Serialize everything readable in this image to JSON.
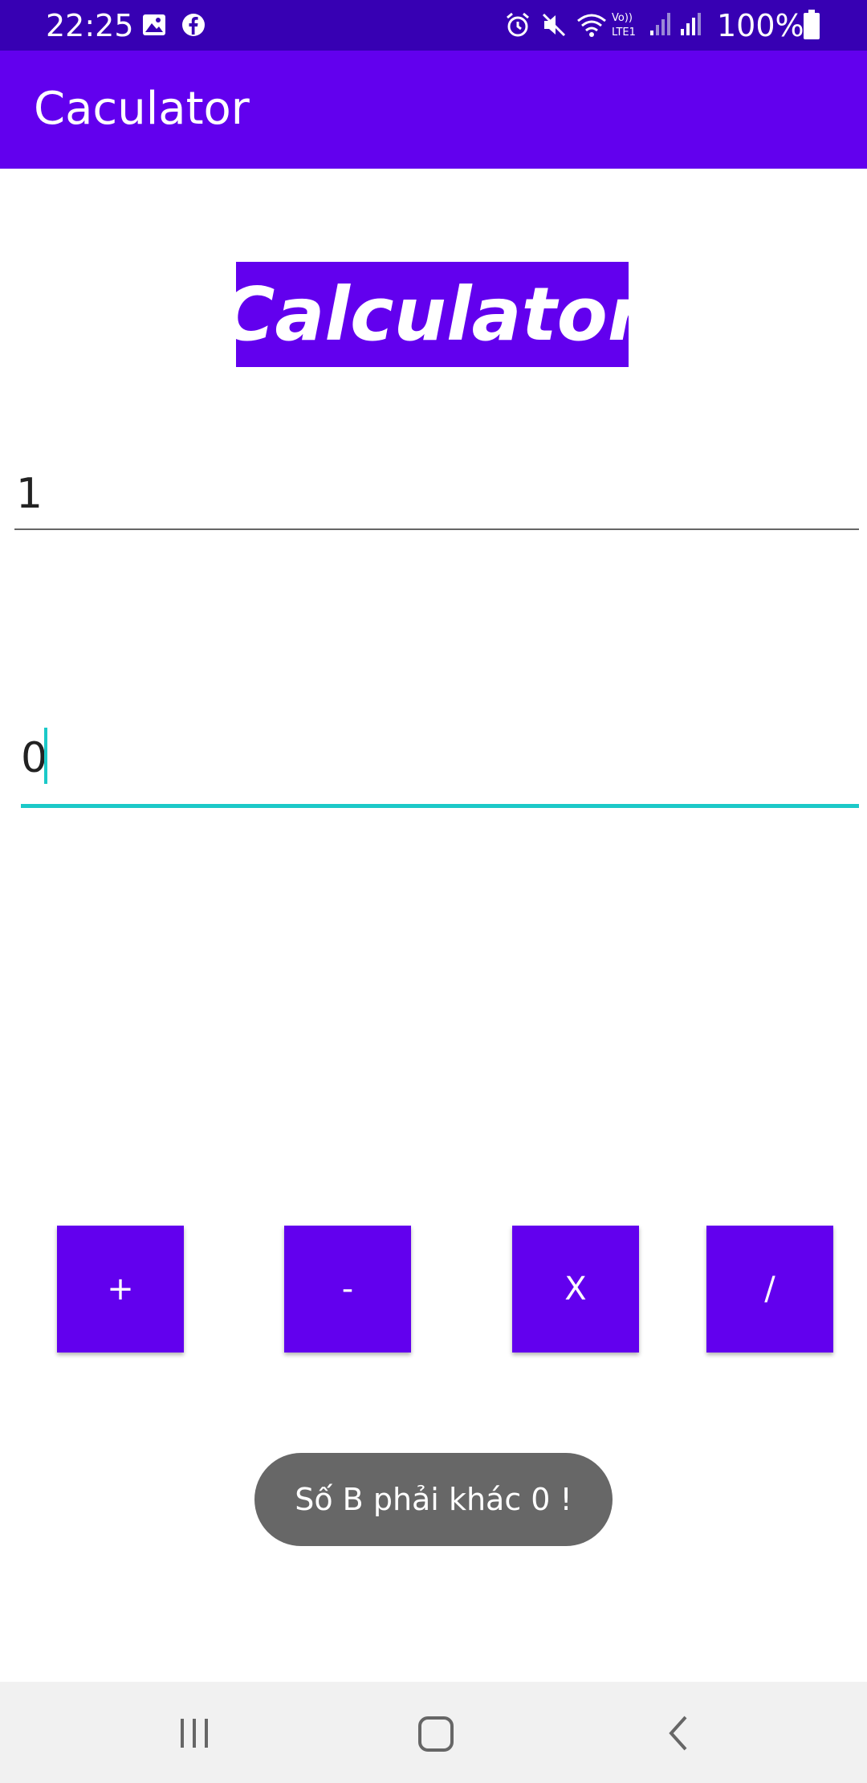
{
  "status_bar": {
    "time": "22:25",
    "battery": "100%",
    "icons": [
      "image-icon",
      "facebook-icon",
      "alarm-icon",
      "mute-icon",
      "wifi-icon",
      "volte-icon",
      "signal-icon",
      "signal-icon",
      "battery-icon"
    ]
  },
  "app_bar": {
    "title": "Caculator"
  },
  "heading": {
    "text": "Calculator"
  },
  "inputs": {
    "a_value": "1",
    "b_value": "0"
  },
  "buttons": {
    "add": "+",
    "subtract": "-",
    "multiply": "X",
    "divide": "/"
  },
  "toast": {
    "text": "Số B phải khác 0 !"
  },
  "nav_bar": {
    "icons": [
      "recent-apps-icon",
      "home-icon",
      "back-icon"
    ]
  },
  "colors": {
    "primary": "#6200ee",
    "primary_dark": "#3700b3",
    "accent": "#1bc9c8",
    "toast_bg": "#676767"
  }
}
